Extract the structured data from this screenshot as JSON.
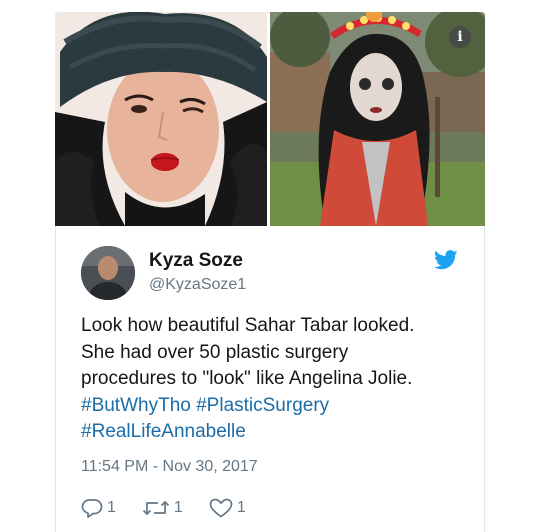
{
  "tweet": {
    "display_name": "Kyza Soze",
    "handle": "@KyzaSoze1",
    "text_lines": [
      "Look how beautiful Sahar Tabar looked.",
      "She had over 50 plastic surgery",
      "procedures to \"look\" like Angelina Jolie."
    ],
    "hashtags_line1": [
      "#ButWhyTho",
      "#PlasticSurgery"
    ],
    "hashtags_line2": [
      "#RealLifeAnnabelle"
    ],
    "timestamp": "11:54 PM - Nov 30, 2017",
    "actions": {
      "reply_count": "1",
      "retweet_count": "1",
      "like_count": "1"
    }
  },
  "media": {
    "info_label": "i"
  },
  "icons": {
    "brand": "twitter-bird-icon",
    "reply": "reply-icon",
    "retweet": "retweet-icon",
    "like": "heart-icon",
    "info": "info-icon"
  },
  "colors": {
    "brand_blue": "#1da1f2",
    "hashtag": "#1b6ca8",
    "text": "#14171a",
    "muted": "#657786",
    "border": "#e1e8ed"
  }
}
